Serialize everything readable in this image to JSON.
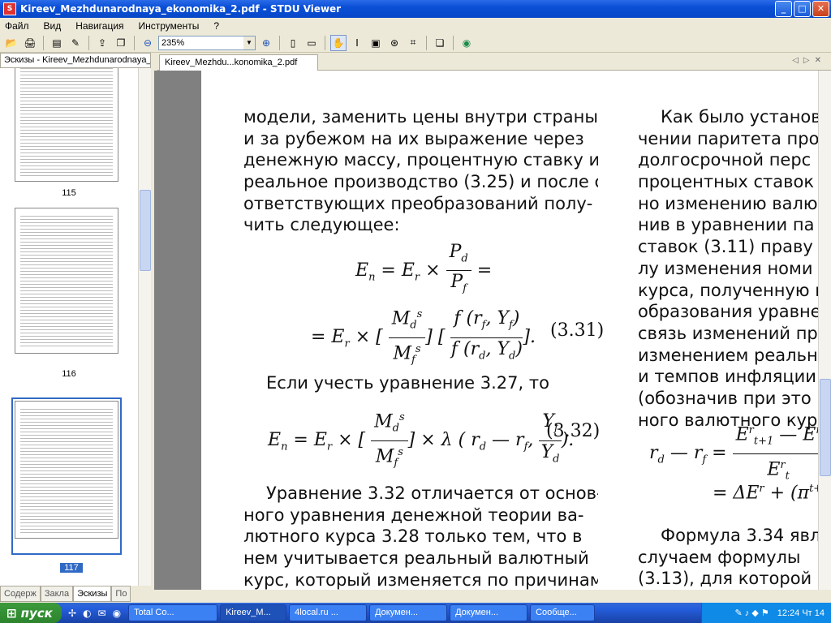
{
  "window": {
    "title": "Kireev_Mezhdunarodnaya_ekonomika_2.pdf - STDU Viewer",
    "buttons": {
      "minimize": "_",
      "maximize": "□",
      "close": "✕"
    }
  },
  "menu": [
    "Файл",
    "Вид",
    "Навигация",
    "Инструменты",
    "?"
  ],
  "toolbar": {
    "zoom_value": "235%"
  },
  "sidebar": {
    "header": "Эскизы - Kireev_Mezhdunarodnaya_e",
    "pages": [
      "115",
      "116",
      "117"
    ],
    "selected_page": "117",
    "tabs": [
      "Содерж",
      "Закла",
      "Эскизы",
      "По"
    ]
  },
  "document": {
    "tab_label": "Kireev_Mezhdu...konomika_2.pdf",
    "left_column": [
      "модели, заменить цены внутри страны",
      "и за рубежом на их выражение через",
      "денежную массу, процентную ставку и",
      "реальное производство (3.25) и после со-",
      "ответствующих преобразований полу-",
      "чить следующее:"
    ],
    "left_column_2": [
      "Если учесть уравнение 3.27, то"
    ],
    "left_column_3": [
      "Уравнение 3.32 отличается от основ-",
      "ного уравнения денежной теории ва-",
      "лютного курса 3.28 только тем, что в",
      "нем учитывается реальный валютный",
      "курс, который изменяется по причинам"
    ],
    "right_column": [
      "Как было установ",
      "чении паритета про",
      "долгосрочной перс",
      "процентных ставок м",
      "но изменению валю",
      "нив в уравнении па",
      "ставок (3.11) праву",
      "лу изменения номи",
      "курса, полученную п",
      "образования уравне",
      "связь изменений пр",
      "изменением реально",
      "и темпов инфляции",
      "(обозначив при это",
      "ного валютного кур"
    ],
    "right_column_2": [
      "Формула 3.34 явл",
      "случаем формулы",
      "(3.13), для которой"
    ],
    "eq_3_31_label": "(3.31)",
    "eq_3_32_label": "(3.32)"
  },
  "taskbar": {
    "start": "пуск",
    "tasks": [
      "Total Co...",
      "Kireev_M...",
      "4local.ru ...",
      "Докумен...",
      "Докумен...",
      "Сообще..."
    ],
    "active_task": "Kireev_M...",
    "clock": "12:24 Чт 14"
  }
}
